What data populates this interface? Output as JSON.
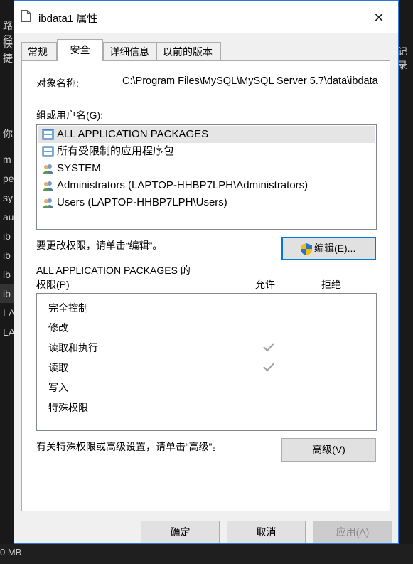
{
  "background": {
    "left_items": [
      "路径",
      "快捷",
      "你",
      "m",
      "pe",
      "sy",
      "au",
      "ib",
      "ib",
      "ib",
      "ib",
      "LA",
      "LA"
    ],
    "right_items": [
      "记录"
    ],
    "status": "0 MB"
  },
  "window": {
    "title": "ibdata1 属性",
    "close_glyph": "✕"
  },
  "tabs": [
    "常规",
    "安全",
    "详细信息",
    "以前的版本"
  ],
  "active_tab": 1,
  "security": {
    "object_name_label": "对象名称:",
    "object_name_value": "C:\\Program Files\\MySQL\\MySQL Server 5.7\\data\\ibdata1",
    "groups_label": "组或用户名(G):",
    "principals": [
      {
        "name": "ALL APPLICATION PACKAGES",
        "icon": "app-package-icon",
        "selected": true
      },
      {
        "name": "所有受限制的应用程序包",
        "icon": "app-package-icon",
        "selected": false
      },
      {
        "name": "SYSTEM",
        "icon": "users-icon",
        "selected": false
      },
      {
        "name": "Administrators (LAPTOP-HHBP7LPH\\Administrators)",
        "icon": "users-icon",
        "selected": false
      },
      {
        "name": "Users (LAPTOP-HHBP7LPH\\Users)",
        "icon": "users-icon",
        "selected": false
      }
    ],
    "edit_hint": "要更改权限，请单击“编辑”。",
    "edit_button": "编辑(E)...",
    "perm_title_line1": "ALL APPLICATION PACKAGES 的",
    "perm_title_line2": "权限(P)",
    "allow_header": "允许",
    "deny_header": "拒绝",
    "permissions": [
      {
        "name": "完全控制",
        "allow": false,
        "deny": false
      },
      {
        "name": "修改",
        "allow": false,
        "deny": false
      },
      {
        "name": "读取和执行",
        "allow": true,
        "deny": false
      },
      {
        "name": "读取",
        "allow": true,
        "deny": false
      },
      {
        "name": "写入",
        "allow": false,
        "deny": false
      },
      {
        "name": "特殊权限",
        "allow": false,
        "deny": false
      }
    ],
    "advanced_hint": "有关特殊权限或高级设置，请单击“高级”。",
    "advanced_button": "高级(V)"
  },
  "buttons": {
    "ok": "确定",
    "cancel": "取消",
    "apply": "应用(A)"
  },
  "colors": {
    "accent": "#0078d7",
    "selection": "#e5e5e5",
    "check": "#a0a0a0"
  }
}
